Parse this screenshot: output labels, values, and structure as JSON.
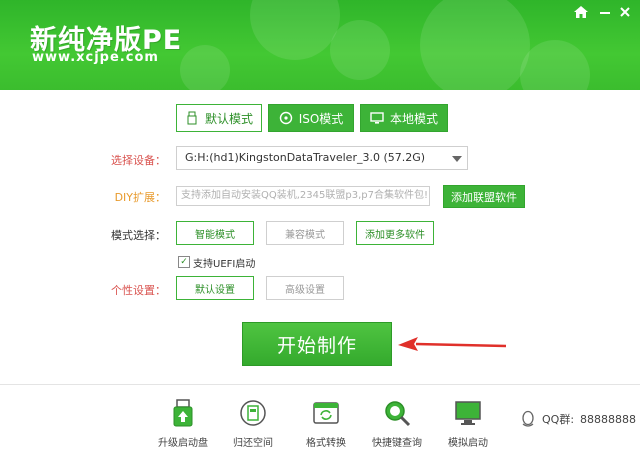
{
  "header": {
    "title": "新纯净版PE",
    "url": "www.xcjpe.com",
    "home_icon": "home-icon",
    "minimize_icon": "minimize-icon",
    "close_icon": "close-icon"
  },
  "tabs": [
    {
      "label": "默认模式",
      "icon": "usb-icon",
      "state": "active"
    },
    {
      "label": "ISO模式",
      "icon": "disc-icon",
      "state": "normal"
    },
    {
      "label": "本地模式",
      "icon": "monitor-icon",
      "state": "normal"
    }
  ],
  "device": {
    "label": "选择设备：",
    "value": "G:H:(hd1)KingstonDataTraveler_3.0 (57.2G)"
  },
  "diy": {
    "label": "DIY扩展：",
    "placeholder": "支持添加自动安装QQ装机,2345联盟p3,p7合集软件包!",
    "add_button": "添加联盟软件"
  },
  "mode": {
    "label": "模式选择：",
    "options": [
      "智能模式",
      "兼容模式",
      "添加更多软件"
    ],
    "selected": "智能模式"
  },
  "uefi": {
    "label": "支持UEFI启动",
    "checked": true
  },
  "personal": {
    "label": "个性设置：",
    "options": [
      "默认设置",
      "高级设置"
    ],
    "selected": "默认设置"
  },
  "start_button": "开始制作",
  "colors": {
    "brand_green": "#3db338",
    "header_green": "#43c833",
    "arrow_red": "#e0302a"
  },
  "tools": [
    {
      "label": "升级启动盘",
      "icon": "usb-upgrade-icon"
    },
    {
      "label": "归还空间",
      "icon": "restore-space-icon"
    },
    {
      "label": "格式转换",
      "icon": "format-convert-icon"
    },
    {
      "label": "快捷键查询",
      "icon": "hotkey-search-icon"
    },
    {
      "label": "模拟启动",
      "icon": "simulate-boot-icon"
    }
  ],
  "qq": {
    "label": "QQ群:",
    "number": "88888888",
    "icon": "qq-penguin-icon"
  }
}
